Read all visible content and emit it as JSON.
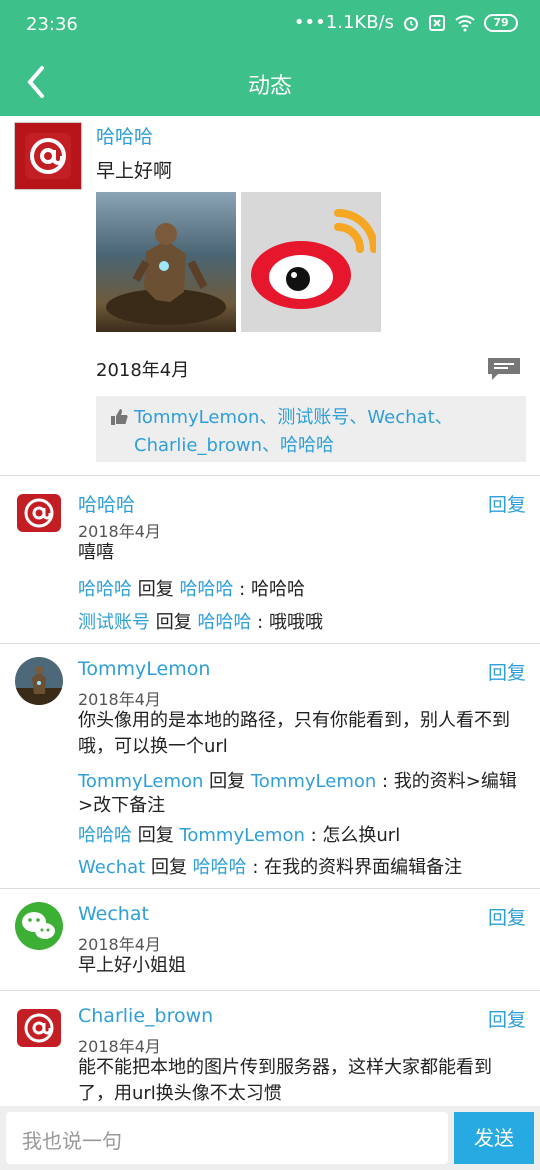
{
  "status_bar": {
    "time": "23:36",
    "network": "•••1.1KB/s",
    "battery": "79"
  },
  "nav": {
    "title": "动态"
  },
  "post": {
    "author": "哈哈哈",
    "text": "早上好啊",
    "date": "2018年4月",
    "likes": "TommyLemon、测试账号、Wechat、Charlie_brown、哈哈哈"
  },
  "comments": [
    {
      "name": "哈哈哈",
      "reply": "回复",
      "date": "2018年4月",
      "body": "嘻嘻",
      "subs": [
        {
          "from": "哈哈哈",
          "verb": " 回复 ",
          "to": "哈哈哈",
          "text": " : 哈哈哈"
        },
        {
          "from": "测试账号",
          "verb": " 回复 ",
          "to": "哈哈哈",
          "text": " : 哦哦哦"
        }
      ]
    },
    {
      "name": "TommyLemon",
      "reply": "回复",
      "date": "2018年4月",
      "body": "你头像用的是本地的路径，只有你能看到，别人看不到哦，可以换一个url",
      "subs": [
        {
          "from": "TommyLemon",
          "verb": " 回复 ",
          "to": "TommyLemon",
          "text": " : 我的资料>编辑>改下备注"
        },
        {
          "from": "哈哈哈",
          "verb": " 回复 ",
          "to": "TommyLemon",
          "text": " : 怎么换url"
        },
        {
          "from": "Wechat",
          "verb": " 回复 ",
          "to": "哈哈哈",
          "text": " : 在我的资料界面编辑备注"
        }
      ]
    },
    {
      "name": "Wechat",
      "reply": "回复",
      "date": "2018年4月",
      "body": "早上好小姐姐",
      "subs": []
    },
    {
      "name": "Charlie_brown",
      "reply": "回复",
      "date": "2018年4月",
      "body": "能不能把本地的图片传到服务器，这样大家都能看到了，用url换头像不太习惯",
      "subs": []
    }
  ],
  "footer": {
    "placeholder": "我也说一句",
    "send": "发送"
  },
  "colors": {
    "header": "#3ec08b",
    "link": "#2f9fd8",
    "send": "#27a9e1"
  }
}
